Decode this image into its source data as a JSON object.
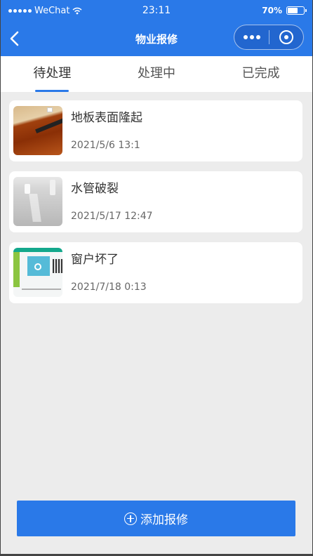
{
  "status_bar": {
    "carrier": "WeChat",
    "time": "23:11",
    "battery": "70%",
    "battery_level": 0.7
  },
  "nav": {
    "title": "物业报修"
  },
  "tabs": [
    {
      "label": "待处理",
      "active": true
    },
    {
      "label": "处理中",
      "active": false
    },
    {
      "label": "已完成",
      "active": false
    }
  ],
  "repairs": [
    {
      "title": "地板表面隆起",
      "time": "2021/5/6 13:1",
      "thumb": "floor-photo"
    },
    {
      "title": "水管破裂",
      "time": "2021/5/17 12:47",
      "thumb": "pipe-photo"
    },
    {
      "title": "窗户坏了",
      "time": "2021/7/18 0:13",
      "thumb": "window-screenshot"
    }
  ],
  "add_button": {
    "label": "添加报修",
    "icon": "plus-circle-icon"
  },
  "colors": {
    "primary": "#2a79e8",
    "background": "#ececec"
  }
}
